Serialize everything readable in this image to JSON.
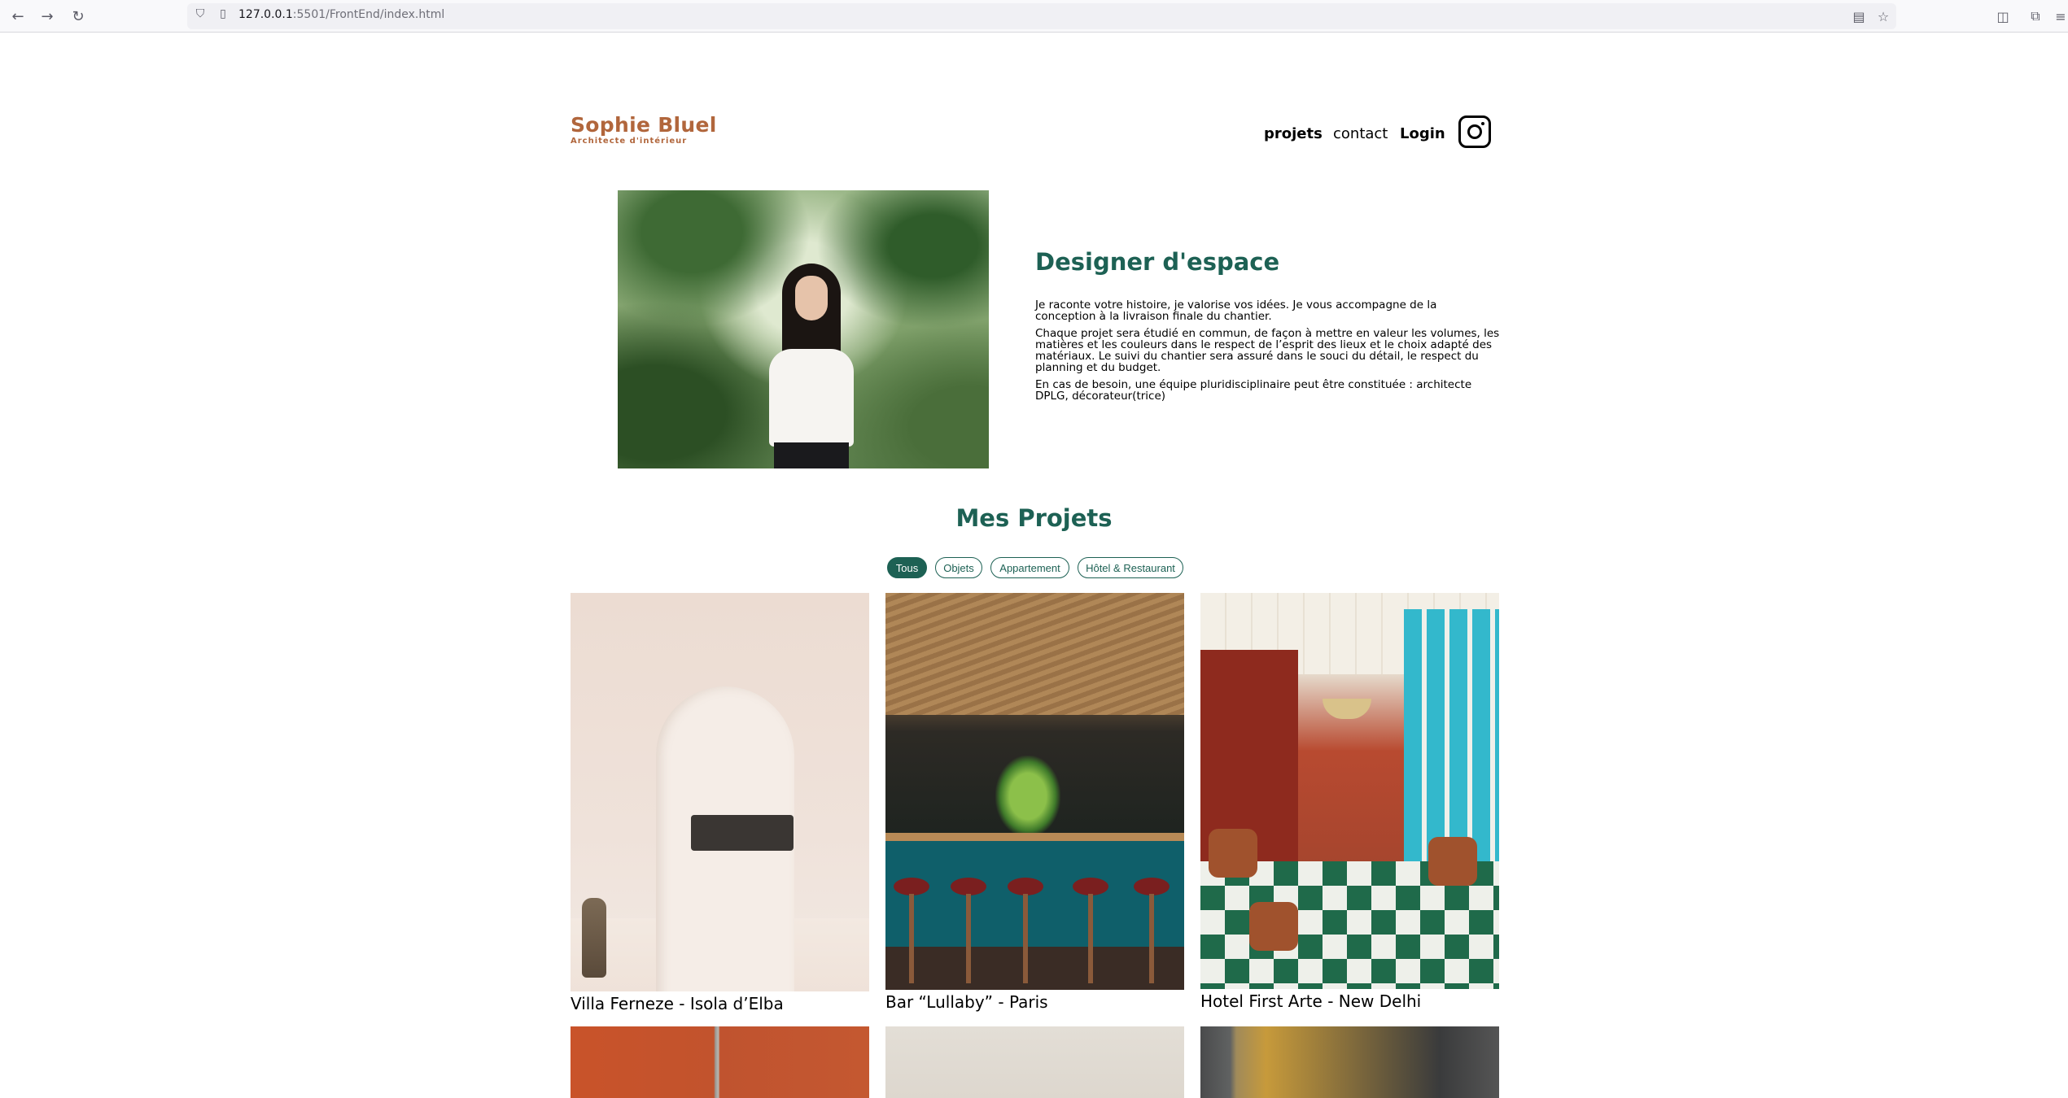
{
  "browser": {
    "url_host": "127.0.0.1",
    "url_rest": ":5501/FrontEnd/index.html"
  },
  "header": {
    "logo_title": "Sophie Bluel",
    "logo_subtitle": "Architecte d'intérieur",
    "nav": {
      "projets": "projets",
      "contact": "contact",
      "login": "Login"
    }
  },
  "intro": {
    "title": "Designer d'espace",
    "paragraphs": [
      "Je raconte votre histoire, je valorise vos idées. Je vous accompagne de la conception à la livraison finale du chantier.",
      "Chaque projet sera étudié en commun, de façon à mettre en valeur les volumes, les matières et les couleurs dans le respect de l’esprit des lieux et le choix adapté des matériaux. Le suivi du chantier sera assuré dans le souci du détail, le respect du planning et du budget.",
      "En cas de besoin, une équipe pluridisciplinaire peut être constituée : architecte DPLG, décorateur(trice)"
    ]
  },
  "projects": {
    "title": "Mes Projets",
    "filters": [
      "Tous",
      "Objets",
      "Appartement",
      "Hôtel & Restaurant"
    ],
    "active_filter": "Tous",
    "items": [
      {
        "caption": "Villa Ferneze - Isola d’Elba"
      },
      {
        "caption": "Bar “Lullaby” - Paris"
      },
      {
        "caption": "Hotel First Arte - New Delhi"
      }
    ]
  },
  "colors": {
    "brand_orange": "#B1663C",
    "brand_green": "#1D6154"
  }
}
